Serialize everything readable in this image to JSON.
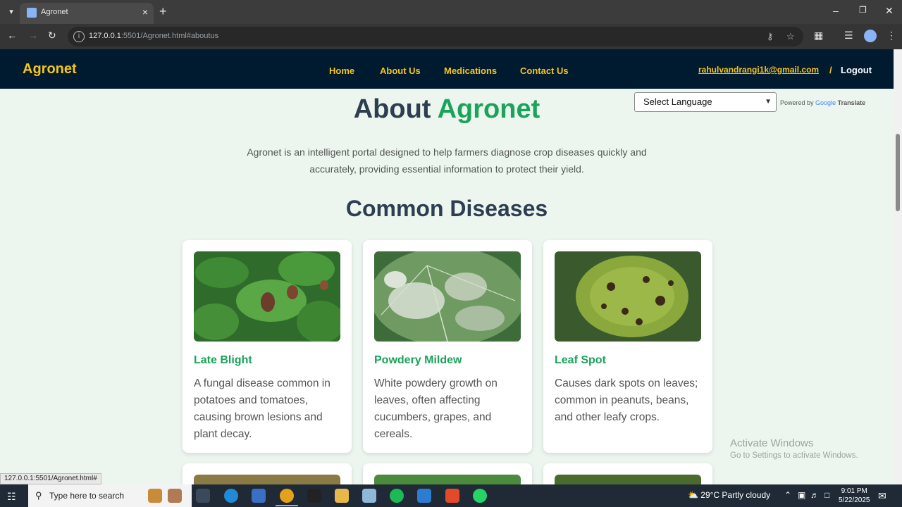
{
  "browser": {
    "tab_title": "Agronet",
    "url_host": "127.0.0.1",
    "url_path": ":5501/Agronet.html#aboutus",
    "status_url": "127.0.0.1:5501/Agronet.html#"
  },
  "header": {
    "brand": "Agronet",
    "nav": [
      "Home",
      "About Us",
      "Medications",
      "Contact Us"
    ],
    "email": "rahulvandrangi1k@gmail.com",
    "separator": "/",
    "logout": "Logout"
  },
  "translate": {
    "select_label": "Select Language",
    "powered_by": "Powered by",
    "google": "Google",
    "translate": "Translate"
  },
  "about": {
    "title_1": "About",
    "title_2": "Agronet",
    "intro": "Agronet is an intelligent portal designed to help farmers diagnose crop diseases quickly and accurately, providing essential information to protect their yield."
  },
  "diseases": {
    "title": "Common Diseases",
    "cards": [
      {
        "title": "Late Blight",
        "desc": "A fungal disease common in potatoes and tomatoes, causing brown lesions and plant decay."
      },
      {
        "title": "Powdery Mildew",
        "desc": "White powdery growth on leaves, often affecting cucumbers, grapes, and cereals."
      },
      {
        "title": "Leaf Spot",
        "desc": "Causes dark spots on leaves; common in peanuts, beans, and other leafy crops."
      }
    ]
  },
  "watermark": {
    "line1": "Activate Windows",
    "line2": "Go to Settings to activate Windows."
  },
  "taskbar": {
    "search_placeholder": "Type here to search",
    "weather": "29°C  Partly cloudy",
    "time": "9:01 PM",
    "date": "5/22/2025"
  },
  "colors": {
    "header_bg": "#001a30",
    "brand_accent": "#f5c518",
    "green_accent": "#1aa35a",
    "page_bg": "#ecf6ef"
  }
}
